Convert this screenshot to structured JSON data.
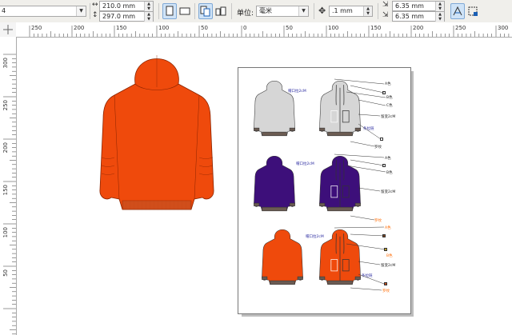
{
  "toolbar": {
    "font_size_value": "4",
    "width_value": "210.0 mm",
    "height_value": "297.0 mm",
    "unit_label": "单位:",
    "unit_value": "毫米",
    "nudge_value": ".1 mm",
    "dup_x_value": "6.35 mm",
    "dup_y_value": "6.35 mm"
  },
  "hruler_ticks": [
    "250",
    "200",
    "150",
    "100",
    "50",
    "0",
    "50",
    "100",
    "150",
    "200",
    "250",
    "300"
  ],
  "vruler_ticks": [
    "300",
    "250",
    "200",
    "150",
    "100",
    "50"
  ],
  "sheet_notes": {
    "row1_left": "帽口拉2cM",
    "row1_r1": "A色",
    "row1_r2": "B色",
    "row1_r3": "C色",
    "row1_r4": "留变2cM",
    "row1_r5": "条拉链",
    "row1_r6": "罗纹",
    "row2_left": "帽口拉2cM",
    "row2_r1": "A色",
    "row2_r2": "B色",
    "row2_r3": "留变2cM",
    "row2_r4": "罗纹",
    "row3_left": "帽口拉2cM",
    "row3_r1": "A色",
    "row3_r2": "B色",
    "row3_r3": "留变2cM",
    "row3_r4": "条拉链",
    "row3_r5": "罗纹"
  },
  "colors": {
    "orange": "#ef4a0c",
    "purple": "#3d0f7a",
    "grey": "#d6d6d6",
    "rib": "#6b5b52",
    "accent_blue": "#1a5fb4",
    "note_blue": "#2a2aa0",
    "note_orange": "#ff6a00"
  }
}
